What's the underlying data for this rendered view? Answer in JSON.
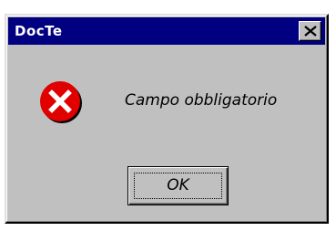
{
  "window": {
    "title": "DocTe"
  },
  "titlebar": {
    "close_icon": "close-x-icon"
  },
  "dialog": {
    "icon": "error-icon",
    "message": "Campo obbligatorio",
    "ok_label": "OK"
  },
  "colors": {
    "titlebar_bg": "#000080",
    "dialog_bg": "#c0c0c0",
    "error_red": "#e00000"
  }
}
